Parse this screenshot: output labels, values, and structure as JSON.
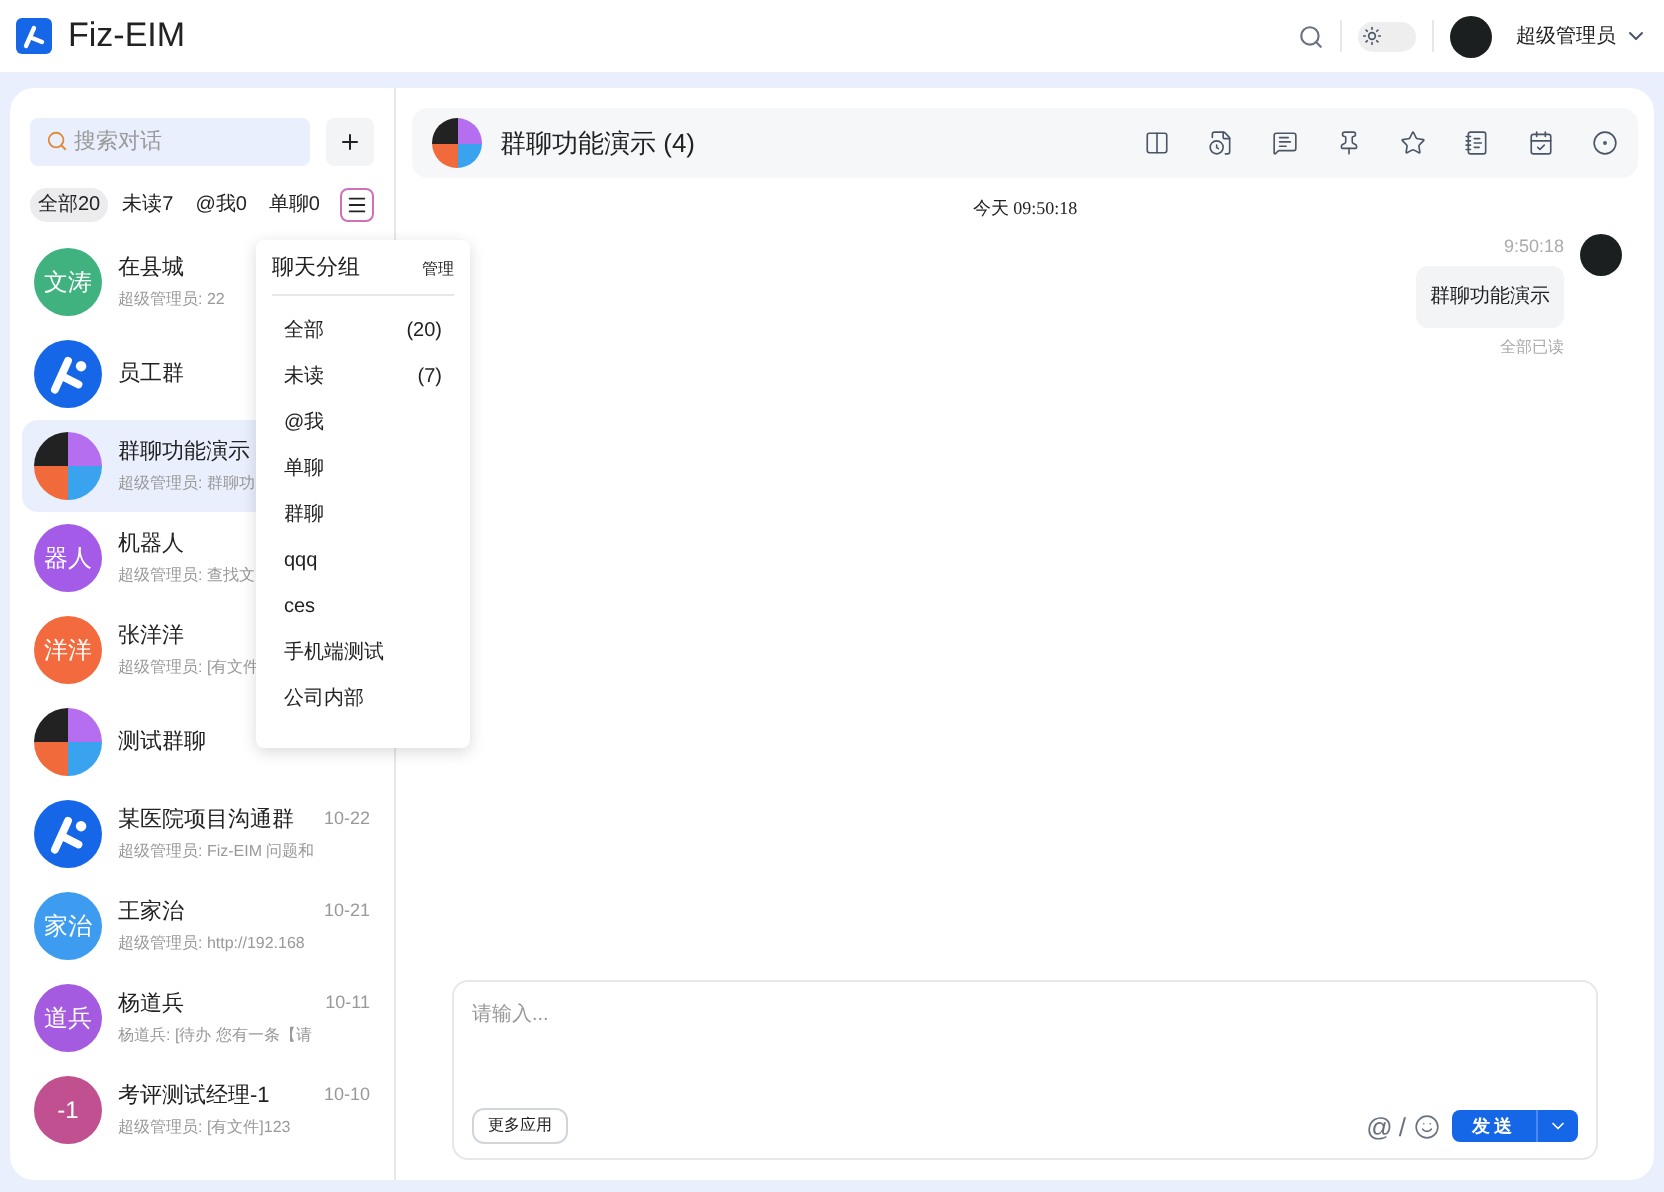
{
  "header": {
    "app_name": "Fiz-EIM",
    "dark_mode": false,
    "user_name": "超级管理员"
  },
  "sidebar": {
    "search": {
      "placeholder": "搜索对话"
    },
    "filters": [
      {
        "label": "全部20",
        "selected": true
      },
      {
        "label": "未读7",
        "selected": false
      },
      {
        "label": "@我0",
        "selected": false
      },
      {
        "label": "单聊0",
        "selected": false
      }
    ],
    "group_menu_open": true,
    "conversations": [
      {
        "kind": "text",
        "avatar_text": "文涛",
        "color": "#3fb27f",
        "name": "在县城",
        "preview": "超级管理员: 22",
        "selected": false
      },
      {
        "kind": "logo",
        "name": "员工群",
        "selected": false
      },
      {
        "kind": "grid",
        "name": "群聊功能演示",
        "preview": "超级管理员: 群聊功",
        "selected": true
      },
      {
        "kind": "text",
        "avatar_text": "器人",
        "color": "#a35be8",
        "name": "机器人",
        "preview": "超级管理员: 查找文",
        "selected": false
      },
      {
        "kind": "text",
        "avatar_text": "洋洋",
        "color": "#f26a3d",
        "name": "张洋洋",
        "preview": "超级管理员: [有文件",
        "selected": false
      },
      {
        "kind": "grid",
        "name": "测试群聊",
        "selected": false
      },
      {
        "kind": "logo",
        "name": "某医院项目沟通群",
        "time": "10-22",
        "preview": "超级管理员: Fiz-EIM 问题和",
        "selected": false
      },
      {
        "kind": "text",
        "avatar_text": "家治",
        "color": "#3d9bf0",
        "name": "王家治",
        "time": "10-21",
        "preview": "超级管理员: http://192.168",
        "selected": false
      },
      {
        "kind": "text",
        "avatar_text": "道兵",
        "color": "#a55be0",
        "name": "杨道兵",
        "time": "10-11",
        "preview": "杨道兵: [待办 您有一条【请",
        "selected": false
      },
      {
        "kind": "text",
        "avatar_text": "-1",
        "color": "#c0508f",
        "name": "考评测试经理-1",
        "time": "10-10",
        "preview": "超级管理员: [有文件]123",
        "selected": false
      }
    ]
  },
  "group_menu": {
    "title": "聊天分组",
    "manage": "管理",
    "items": [
      {
        "label": "全部",
        "count": "(20)"
      },
      {
        "label": "未读",
        "count": "(7)"
      },
      {
        "label": "@我"
      },
      {
        "label": "单聊"
      },
      {
        "label": "群聊"
      },
      {
        "label": "qqq"
      },
      {
        "label": "ces"
      },
      {
        "label": "手机端测试"
      },
      {
        "label": "公司内部"
      }
    ]
  },
  "chat": {
    "title": "群聊功能演示 (4)",
    "date_divider": "今天 09:50:18",
    "messages": [
      {
        "time": "9:50:18",
        "text": "群聊功能演示",
        "read_status": "全部已读"
      }
    ],
    "composer": {
      "placeholder": "请输入...",
      "more_apps": "更多应用",
      "at": "@",
      "slash": "/",
      "send": "发送"
    }
  }
}
